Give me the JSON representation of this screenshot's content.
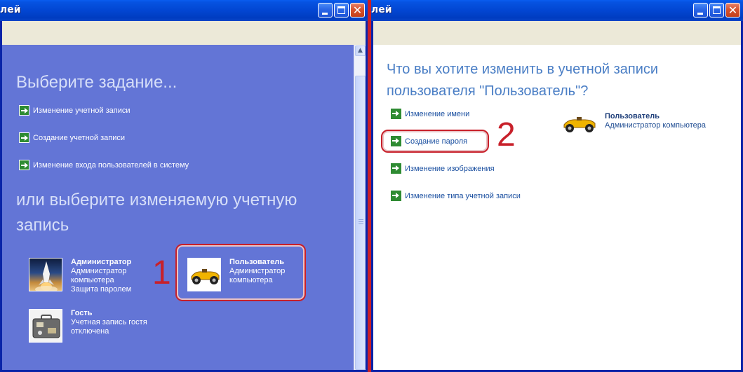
{
  "left_window": {
    "title_fragment": "лей",
    "heading_tasks": "Выберите задание...",
    "tasks": [
      {
        "label": "Изменение учетной записи"
      },
      {
        "label": "Создание учетной записи"
      },
      {
        "label": "Изменение входа пользователей в систему"
      }
    ],
    "heading_accounts": "или выберите изменяемую учетную запись",
    "accounts": [
      {
        "name": "Администратор",
        "line1": "Администратор",
        "line2": "компьютера",
        "line3": "Защита паролем",
        "icon": "rocket-launch-icon"
      },
      {
        "name": "Пользователь",
        "line1": "Администратор",
        "line2": "компьютера",
        "line3": "",
        "icon": "race-car-icon"
      },
      {
        "name": "Гость",
        "line1": "Учетная запись гостя",
        "line2": "отключена",
        "line3": "",
        "icon": "suitcase-icon"
      }
    ],
    "annotation": "1"
  },
  "right_window": {
    "title_fragment": "лей",
    "heading": "Что вы хотите изменить в учетной записи пользователя \"Пользователь\"?",
    "tasks": [
      {
        "label": "Изменение имени"
      },
      {
        "label": "Создание пароля"
      },
      {
        "label": "Изменение изображения"
      },
      {
        "label": "Изменение типа учетной записи"
      }
    ],
    "user": {
      "name": "Пользователь",
      "role": "Администратор компьютера",
      "icon": "race-car-icon"
    },
    "annotation": "2"
  },
  "colors": {
    "xp_title_blue": "#0246d2",
    "left_panel_bg": "#6375d6",
    "annotation_red": "#c8202a",
    "right_heading": "#4a7ec5"
  }
}
